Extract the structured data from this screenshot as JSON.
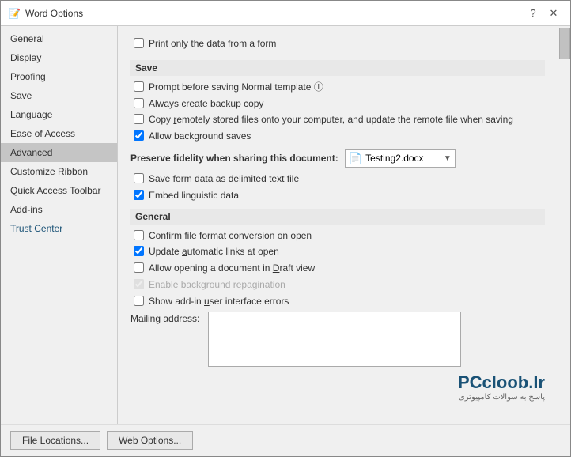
{
  "window": {
    "title": "Word Options",
    "help_btn": "?",
    "close_btn": "✕"
  },
  "sidebar": {
    "items": [
      {
        "id": "general",
        "label": "General",
        "active": false
      },
      {
        "id": "display",
        "label": "Display",
        "active": false
      },
      {
        "id": "proofing",
        "label": "Proofing",
        "active": false
      },
      {
        "id": "save",
        "label": "Save",
        "active": false
      },
      {
        "id": "language",
        "label": "Language",
        "active": false
      },
      {
        "id": "ease-of-access",
        "label": "Ease of Access",
        "active": false
      },
      {
        "id": "advanced",
        "label": "Advanced",
        "active": true
      },
      {
        "id": "customize-ribbon",
        "label": "Customize Ribbon",
        "active": false
      },
      {
        "id": "quick-access-toolbar",
        "label": "Quick Access Toolbar",
        "active": false
      },
      {
        "id": "add-ins",
        "label": "Add-ins",
        "active": false
      },
      {
        "id": "trust-center",
        "label": "Trust Center",
        "active": false,
        "special": true
      }
    ]
  },
  "content": {
    "print_form_label": "Print only the data from a form",
    "save_section": "Save",
    "save_options": [
      {
        "id": "prompt-before-saving",
        "label": "Prompt before saving Normal template",
        "checked": false,
        "info": true
      },
      {
        "id": "always-create-backup",
        "label": "Always create backup copy",
        "checked": false
      },
      {
        "id": "copy-remotely-stored",
        "label": "Copy remotely stored files onto your computer, and update the remote file when saving",
        "checked": false
      },
      {
        "id": "allow-background-saves",
        "label": "Allow background saves",
        "checked": true
      }
    ],
    "preserve_fidelity_label": "Preserve fidelity when sharing this document:",
    "preserve_fidelity_doc": "Testing2.docx",
    "fidelity_options": [
      {
        "id": "save-form-data",
        "label": "Save form data as delimited text file",
        "checked": false
      },
      {
        "id": "embed-linguistic",
        "label": "Embed linguistic data",
        "checked": true
      }
    ],
    "general_section": "General",
    "general_options": [
      {
        "id": "confirm-file-format",
        "label": "Confirm file format conversion on open",
        "checked": false
      },
      {
        "id": "update-auto-links",
        "label": "Update automatic links at open",
        "checked": true
      },
      {
        "id": "allow-opening-draft",
        "label": "Allow opening a document in Draft view",
        "checked": false
      },
      {
        "id": "enable-background-repagination",
        "label": "Enable background repagination",
        "checked": false,
        "disabled": true
      },
      {
        "id": "show-add-in-errors",
        "label": "Show add-in user interface errors",
        "checked": false
      }
    ],
    "mailing_address_label": "Mailing address:",
    "mailing_address_value": "",
    "file_locations_btn": "File Locations...",
    "web_options_btn": "Web Options...",
    "watermark_main": "PCcloob.Ir",
    "watermark_sub": "پاسخ به سوالات کامپیوتری"
  }
}
